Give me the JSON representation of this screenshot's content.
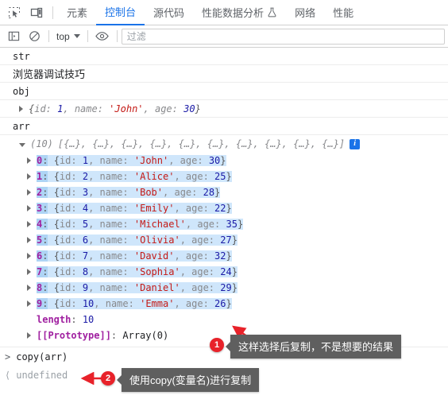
{
  "tabbar": {
    "icons": [
      {
        "name": "inspect-element-icon"
      },
      {
        "name": "device-toolbar-icon"
      }
    ],
    "tabs": [
      {
        "label": "元素",
        "active": false
      },
      {
        "label": "控制台",
        "active": true
      },
      {
        "label": "源代码",
        "active": false
      },
      {
        "label": "性能数据分析",
        "active": false,
        "icon": "flask-icon"
      },
      {
        "label": "网络",
        "active": false
      },
      {
        "label": "性能",
        "active": false
      }
    ],
    "accent_color": "#1a73e8"
  },
  "console_toolbar": {
    "sidebar_toggle_icon": "sidebar-panel-icon",
    "clear_console_icon": "clear-console-icon",
    "context_selector": {
      "value": "top",
      "caret": "chevron-down-icon"
    },
    "eye_icon": "eye-icon",
    "filter": {
      "placeholder": "过滤",
      "value": ""
    }
  },
  "console": {
    "rows": [
      {
        "kind": "log",
        "text": "str"
      },
      {
        "kind": "log",
        "text": "浏览器调试技巧",
        "cjk": true
      },
      {
        "kind": "log",
        "text": "obj"
      },
      {
        "kind": "object-preview",
        "text": "{id: 1, name: 'John', age: 30}"
      },
      {
        "kind": "log",
        "text": "arr"
      }
    ],
    "array": {
      "count_label": "(10)",
      "preview": "[{…}, {…}, {…}, {…}, {…}, {…}, {…}, {…}, {…}, {…}]",
      "info_icon": "info-icon",
      "items": [
        {
          "index": "0",
          "id": "1",
          "name": "John",
          "age": "30"
        },
        {
          "index": "1",
          "id": "2",
          "name": "Alice",
          "age": "25"
        },
        {
          "index": "2",
          "id": "3",
          "name": "Bob",
          "age": "28"
        },
        {
          "index": "3",
          "id": "4",
          "name": "Emily",
          "age": "22"
        },
        {
          "index": "4",
          "id": "5",
          "name": "Michael",
          "age": "35"
        },
        {
          "index": "5",
          "id": "6",
          "name": "Olivia",
          "age": "27"
        },
        {
          "index": "6",
          "id": "7",
          "name": "David",
          "age": "32"
        },
        {
          "index": "7",
          "id": "8",
          "name": "Sophia",
          "age": "24"
        },
        {
          "index": "8",
          "id": "9",
          "name": "Daniel",
          "age": "29"
        },
        {
          "index": "9",
          "id": "10",
          "name": "Emma",
          "age": "26"
        }
      ],
      "length_key": "length",
      "length_value": "10",
      "prototype_key": "[[Prototype]]",
      "prototype_value": "Array(0)"
    },
    "prompt": {
      "input_marker": ">",
      "input_text": "copy(arr)",
      "return_marker": "⟨",
      "return_value": "undefined"
    }
  },
  "annotations": [
    {
      "badge": "1",
      "text": "这样选择后复制，不是想要的结果"
    },
    {
      "badge": "2",
      "text": "使用copy(变量名)进行复制"
    }
  ],
  "colors": {
    "accent": "#1a73e8",
    "selection": "#cfe6fb",
    "selection_band": "#aed4f5",
    "string": "#c41a16",
    "number": "#1a1aa6",
    "index": "#a020a0",
    "callout_bg": "#5f5f5f",
    "badge_bg": "#e8222a"
  }
}
